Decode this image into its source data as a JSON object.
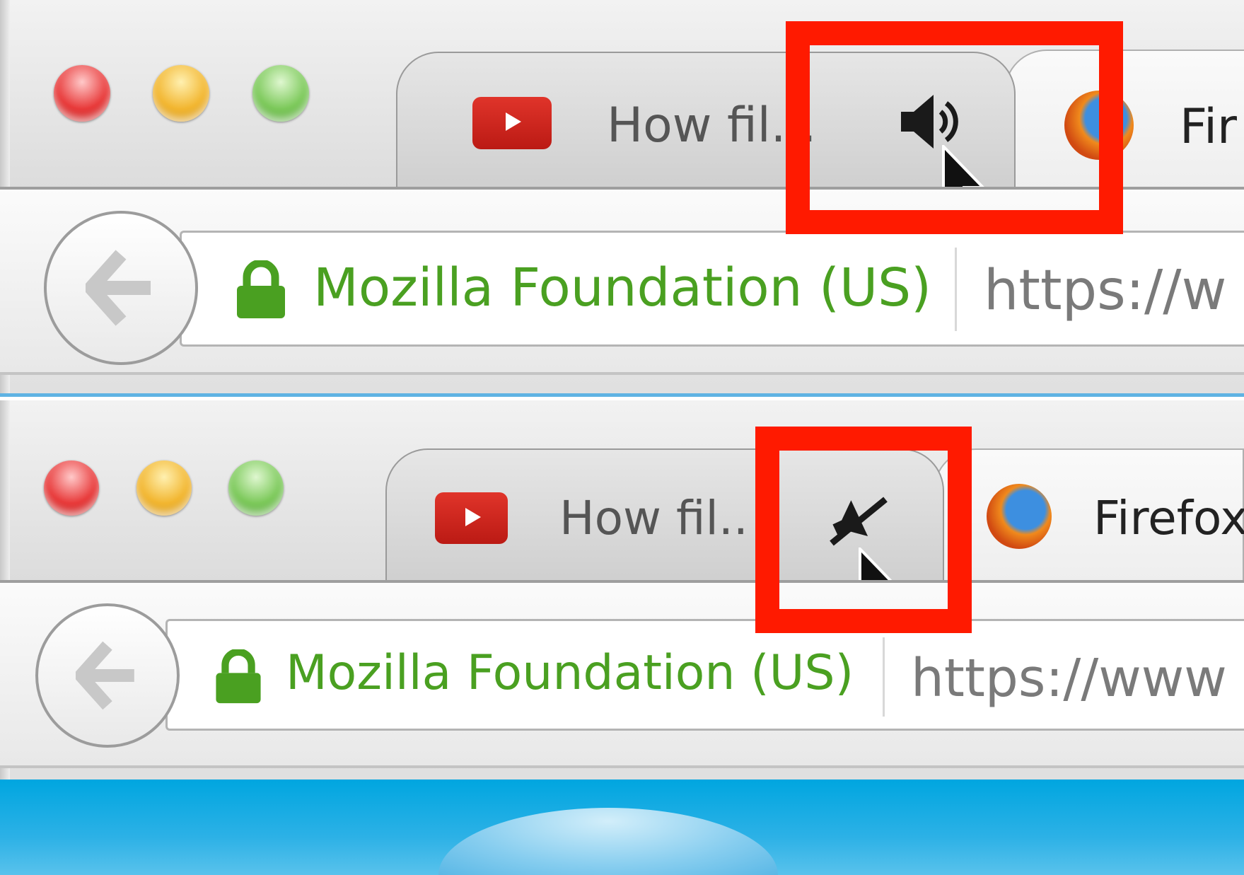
{
  "panels": [
    {
      "state": "playing",
      "tab_active_title": "How fil...",
      "tab_next_title": "Fir",
      "audio_icon": "speaker-playing-icon",
      "identity": "Mozilla Foundation (US)",
      "url": "https://w"
    },
    {
      "state": "muted",
      "tab_active_title": "How fil..",
      "tab_next_title": "Firefox",
      "audio_icon": "speaker-muted-icon",
      "identity": "Mozilla Foundation (US)",
      "url": "https://www"
    }
  ],
  "colors": {
    "highlight": "#ff1a00",
    "identity_green": "#4aa021",
    "separator_blue": "#5fb3e3"
  }
}
